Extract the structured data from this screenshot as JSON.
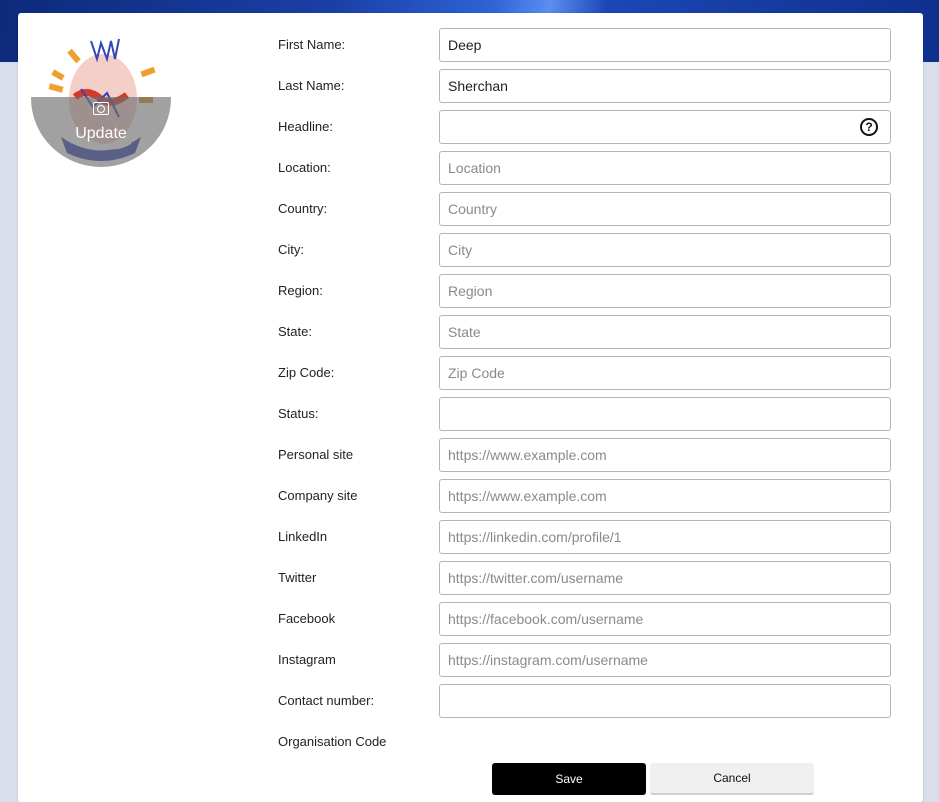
{
  "avatar": {
    "action_label": "Update"
  },
  "fields": [
    {
      "label": "First Name:",
      "value": "Deep",
      "placeholder": ""
    },
    {
      "label": "Last Name:",
      "value": "Sherchan",
      "placeholder": ""
    },
    {
      "label": "Headline:",
      "value": "",
      "placeholder": "",
      "help_icon": "help-circle-icon"
    },
    {
      "label": "Location:",
      "value": "",
      "placeholder": "Location"
    },
    {
      "label": "Country:",
      "value": "",
      "placeholder": "Country"
    },
    {
      "label": "City:",
      "value": "",
      "placeholder": "City"
    },
    {
      "label": "Region:",
      "value": "",
      "placeholder": "Region"
    },
    {
      "label": "State:",
      "value": "",
      "placeholder": "State"
    },
    {
      "label": "Zip Code:",
      "value": "",
      "placeholder": "Zip Code"
    },
    {
      "label": "Status:",
      "value": "",
      "placeholder": ""
    },
    {
      "label": "Personal site",
      "value": "",
      "placeholder": "https://www.example.com"
    },
    {
      "label": "Company site",
      "value": "",
      "placeholder": "https://www.example.com"
    },
    {
      "label": "LinkedIn",
      "value": "",
      "placeholder": "https://linkedin.com/profile/1"
    },
    {
      "label": "Twitter",
      "value": "",
      "placeholder": "https://twitter.com/username"
    },
    {
      "label": "Facebook",
      "value": "",
      "placeholder": "https://facebook.com/username"
    },
    {
      "label": "Instagram",
      "value": "",
      "placeholder": "https://instagram.com/username"
    },
    {
      "label": "Contact number:",
      "value": "",
      "placeholder": ""
    },
    {
      "label": "Organisation Code",
      "value": "",
      "placeholder": ""
    }
  ],
  "help_symbol": "?",
  "actions": {
    "save_label": "Save",
    "cancel_label": "Cancel"
  },
  "colors": {
    "banner": "#1a3fa6",
    "save_bg": "#000000",
    "cancel_bg": "#f0f0f0"
  }
}
